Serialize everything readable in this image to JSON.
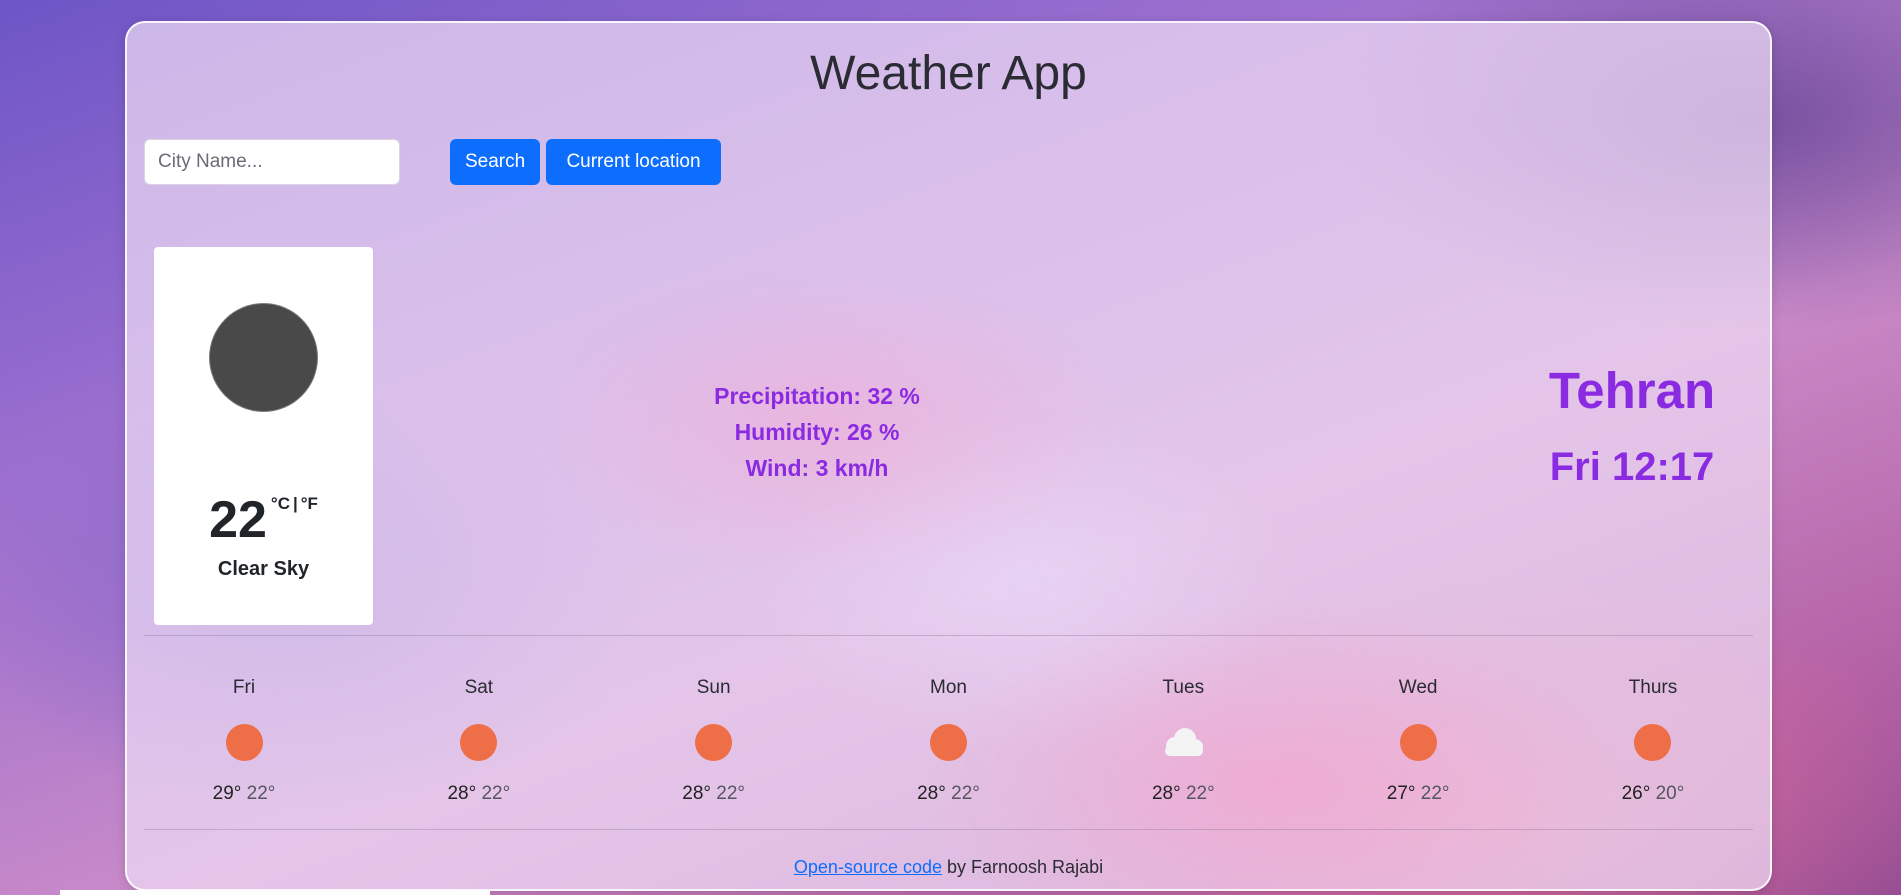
{
  "app": {
    "title": "Weather App"
  },
  "search": {
    "placeholder": "City Name...",
    "value": "",
    "search_label": "Search",
    "location_label": "Current location"
  },
  "current": {
    "icon": "dark-circle-icon",
    "temperature": "22",
    "unit_celsius": "°C",
    "unit_separator": "|",
    "unit_fahrenheit": "°F",
    "condition": "Clear Sky"
  },
  "details": {
    "precipitation": "Precipitation: 32 %",
    "humidity": "Humidity: 26 %",
    "wind": "Wind: 3 km/h"
  },
  "location": {
    "city": "Tehran",
    "datetime": "Fri 12:17"
  },
  "forecast": [
    {
      "day": "Fri",
      "icon": "sun-icon",
      "max": "29°",
      "min": "22°"
    },
    {
      "day": "Sat",
      "icon": "sun-icon",
      "max": "28°",
      "min": "22°"
    },
    {
      "day": "Sun",
      "icon": "sun-icon",
      "max": "28°",
      "min": "22°"
    },
    {
      "day": "Mon",
      "icon": "sun-icon",
      "max": "28°",
      "min": "22°"
    },
    {
      "day": "Tues",
      "icon": "cloud-icon",
      "max": "28°",
      "min": "22°"
    },
    {
      "day": "Wed",
      "icon": "sun-icon",
      "max": "27°",
      "min": "22°"
    },
    {
      "day": "Thurs",
      "icon": "sun-icon",
      "max": "26°",
      "min": "20°"
    }
  ],
  "footer": {
    "link_text": "Open-source code",
    "rest_text": " by Farnoosh Rajabi"
  },
  "colors": {
    "accent": "#8a2be2",
    "button": "#0d6efd",
    "sun": "#ee6e47"
  }
}
